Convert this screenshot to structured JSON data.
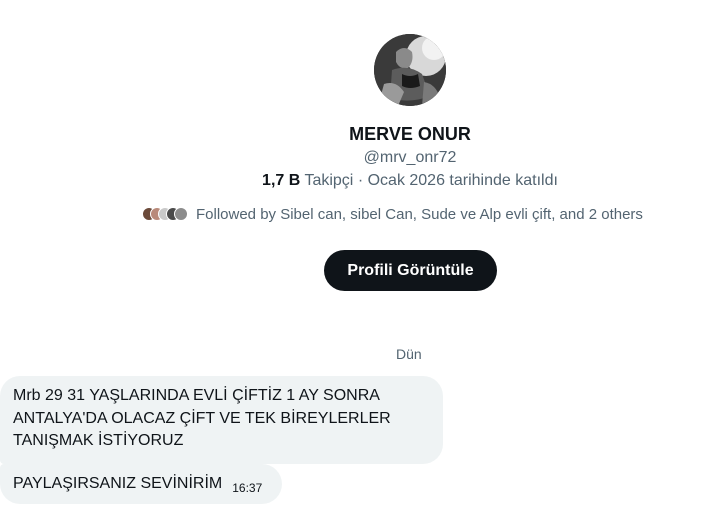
{
  "profile": {
    "name": "MERVE ONUR",
    "handle": "@mrv_onr72",
    "followers_count": "1,7 B",
    "followers_label": "Takipçi",
    "separator": "·",
    "joined": "Ocak 2026 tarihinde katıldı",
    "followed_by": "Followed by Sibel can, sibel Can, Sude ve Alp evli çift, and 2 others",
    "view_profile_button": "Profili Görüntüle"
  },
  "colors": {
    "primary_text": "#0f1419",
    "secondary_text": "#536471",
    "bubble_bg": "#eff3f4",
    "button_bg": "#0f1419"
  },
  "conversation": {
    "day_label": "Dün",
    "messages": [
      {
        "lines": [
          "Mrb 29 31 YAŞLARINDA EVLİ ÇİFTİZ 1 AY SONRA",
          "ANTALYA'DA OLACAZ ÇİFT VE TEK BİREYLERLER",
          "TANIŞMAK İSTİYORUZ"
        ]
      },
      {
        "text": "PAYLAŞIRSANIZ SEVİNİRİM",
        "time": "16:37"
      }
    ]
  }
}
